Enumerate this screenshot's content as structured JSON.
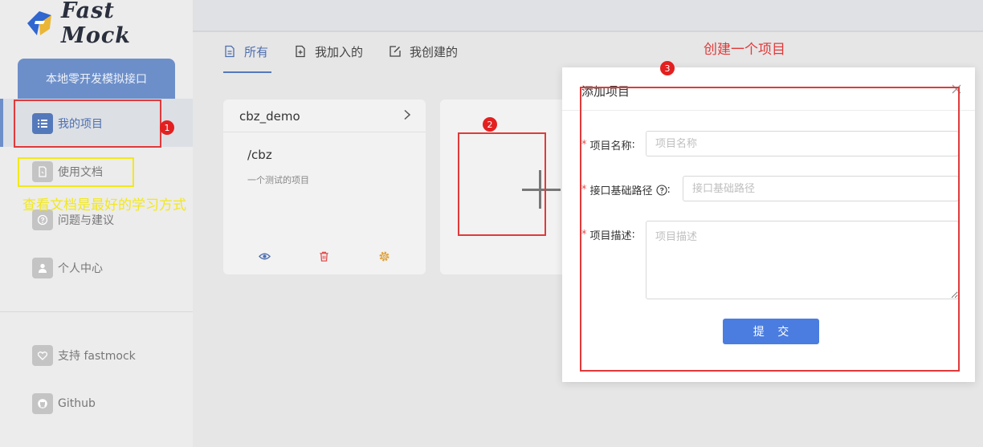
{
  "app": {
    "logo_text": "Fast Mock"
  },
  "sidebar": {
    "local_dev": "本地零开发模拟接口",
    "items": [
      {
        "label": "我的项目",
        "icon": "list-icon",
        "active": true
      },
      {
        "label": "使用文档",
        "icon": "document-icon"
      },
      {
        "label": "问题与建议",
        "icon": "question-icon"
      },
      {
        "label": "个人中心",
        "icon": "user-icon"
      },
      {
        "label": "支持 fastmock",
        "icon": "heart-icon"
      },
      {
        "label": "Github",
        "icon": "github-icon"
      }
    ]
  },
  "tabs": [
    {
      "label": "所有",
      "icon": "file-icon",
      "active": true
    },
    {
      "label": "我加入的",
      "icon": "file-plus-icon"
    },
    {
      "label": "我创建的",
      "icon": "edit-icon"
    }
  ],
  "project_card": {
    "name": "cbz_demo",
    "path": "/cbz",
    "description": "一个测试的项目",
    "actions": [
      "eye-icon",
      "trash-icon",
      "gear-icon"
    ]
  },
  "add_card": {
    "icon": "plus-icon"
  },
  "modal": {
    "title": "添加项目",
    "fields": {
      "name": {
        "label": "项目名称",
        "placeholder": "项目名称",
        "value": ""
      },
      "base_path": {
        "label": "接口基础路径",
        "placeholder": "接口基础路径",
        "value": ""
      },
      "description": {
        "label": "项目描述",
        "placeholder": "项目描述",
        "value": ""
      }
    },
    "submit_label": "提 交"
  },
  "annotations": {
    "n1": "1",
    "n2": "2",
    "n3": "3",
    "docs_tip": "查看文档是最好的学习方式",
    "create_tip": "创建一个项目"
  },
  "colors": {
    "accent": "#4b7de0",
    "annotation_red": "#e03a3a",
    "annotation_yellow": "#f2e81b"
  }
}
